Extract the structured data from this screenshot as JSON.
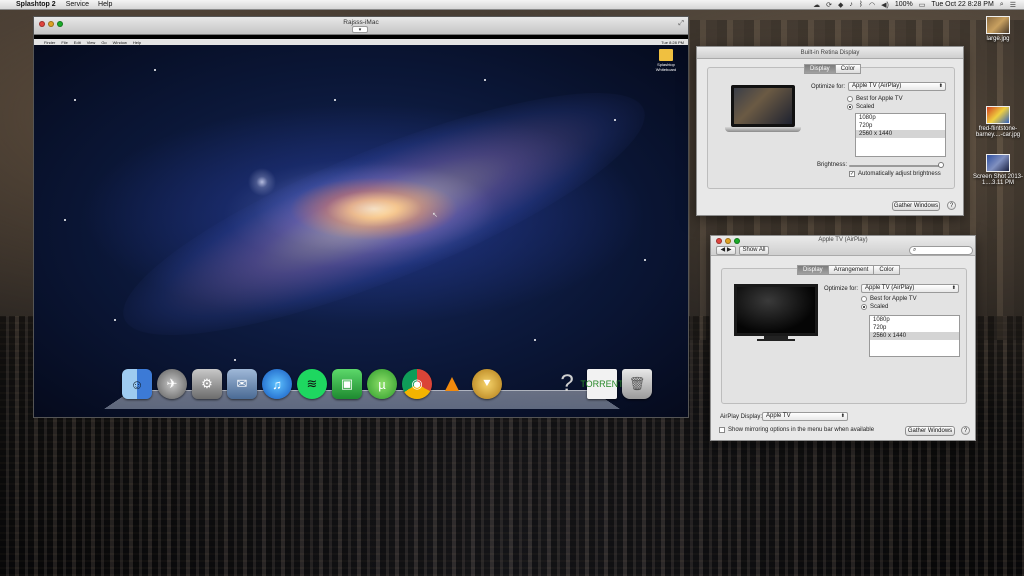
{
  "menubar": {
    "app_name": "Splashtop 2",
    "items": [
      "Service",
      "Help"
    ],
    "battery": "100%",
    "clock": "Tue Oct 22  8:28 PM"
  },
  "remote_window": {
    "title": "Rajsss-iMac",
    "remote_menu": [
      "Finder",
      "File",
      "Edit",
      "View",
      "Go",
      "Window",
      "Help"
    ],
    "remote_clock": "Tue 8:28 PM",
    "desktop_file": "Splashtop Whiteboard",
    "dock_items": [
      "finder-icon",
      "launchpad-icon",
      "system-preferences-icon",
      "mail-icon",
      "itunes-icon",
      "spotify-icon",
      "splashtop-icon",
      "utorrent-icon",
      "chrome-icon",
      "vlc-icon",
      "plex-icon",
      "help-icon",
      "torrent-file-icon",
      "trash-icon"
    ],
    "dock_glyphs": [
      "☺",
      "✈",
      "⚙",
      "✉",
      "♫",
      "≋",
      "▣",
      "µ",
      "◉",
      "▲",
      "⯆",
      "?",
      "TORRENT",
      "🗑"
    ]
  },
  "retina_prefs": {
    "title": "Built-in Retina Display",
    "tabs": [
      "Display",
      "Color"
    ],
    "optimize_label": "Optimize for:",
    "optimize_value": "Apple TV (AirPlay)",
    "radio_best": "Best for Apple TV",
    "radio_scaled": "Scaled",
    "resolutions": [
      "1080p",
      "720p",
      "2560 x 1440"
    ],
    "brightness_label": "Brightness:",
    "auto_brightness": "Automatically adjust brightness",
    "gather_button": "Gather Windows",
    "help": "?"
  },
  "appletv_prefs": {
    "title": "Apple TV (AirPlay)",
    "show_all": "Show All",
    "search_placeholder": "",
    "tabs": [
      "Display",
      "Arrangement",
      "Color"
    ],
    "optimize_label": "Optimize for:",
    "optimize_value": "Apple TV (AirPlay)",
    "radio_best": "Best for Apple TV",
    "radio_scaled": "Scaled",
    "resolutions": [
      "1080p",
      "720p",
      "2560 x 1440"
    ],
    "airplay_label": "AirPlay Display:",
    "airplay_value": "Apple TV",
    "mirroring_option": "Show mirroring options in the menu bar when available",
    "gather_button": "Gather Windows",
    "help": "?"
  },
  "desktop_icons": [
    {
      "label": "large.jpg"
    },
    {
      "label": "fred-flintstone-barney....-car.jpg"
    },
    {
      "label": "Screen Shot 2013-1....3.11 PM"
    }
  ]
}
